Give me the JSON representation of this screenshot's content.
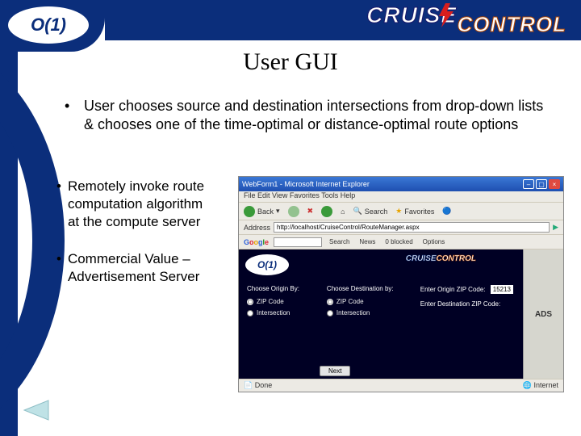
{
  "logo_text": "O(1)",
  "brand": {
    "cruise": "CRUISE",
    "control": "CONTROL"
  },
  "title": "User GUI",
  "bullet_main": "User chooses source and destination intersections from drop-down lists & chooses one of the time-optimal or distance-optimal route options",
  "bullet_left_1": "Remotely invoke route computation algorithm at the compute server",
  "bullet_left_2": "Commercial Value – Advertisement Server",
  "browser": {
    "window_title": "WebForm1 - Microsoft Internet Explorer",
    "menubar": "File  Edit  View  Favorites  Tools  Help",
    "toolbar": {
      "back": "Back",
      "search": "Search",
      "favorites": "Favorites"
    },
    "address_label": "Address",
    "address_value": "http://localhost/CruiseControl/RouteManager.aspx",
    "googlebar": {
      "logo": "Google",
      "search_btn": "Search",
      "news": "News",
      "blocked": "0 blocked",
      "options": "Options"
    },
    "status_left": "Done",
    "status_right": "Internet"
  },
  "page": {
    "origin_header": "Choose Origin By:",
    "dest_header": "Choose Destination by:",
    "opt_zip": "ZIP Code",
    "opt_intersection": "Intersection",
    "enter_origin_zip": "Enter Origin ZIP Code:",
    "origin_zip_value": "15213",
    "enter_dest_zip": "Enter Destination ZIP Code:",
    "next": "Next",
    "ad_label": "ADS"
  }
}
